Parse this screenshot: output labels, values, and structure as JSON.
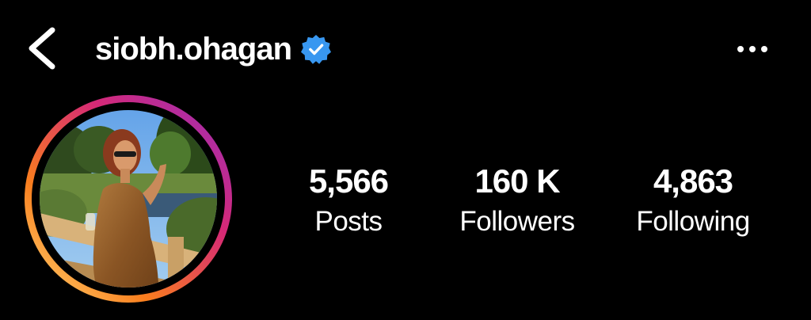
{
  "header": {
    "back_icon": "chevron-left-icon",
    "username": "siobh.ohagan",
    "verified_icon": "verified-badge-icon",
    "more_icon": "more-horizontal-icon"
  },
  "profile": {
    "avatar_icon": "profile-photo",
    "story_ring_colors": [
      "#feda75",
      "#fa7e1e",
      "#d62976",
      "#962fbf"
    ]
  },
  "stats": [
    {
      "value": "5,566",
      "label": "Posts"
    },
    {
      "value": "160 K",
      "label": "Followers"
    },
    {
      "value": "4,863",
      "label": "Following"
    }
  ],
  "colors": {
    "background": "#000000",
    "text": "#ffffff",
    "verified_blue": "#3897f0"
  }
}
